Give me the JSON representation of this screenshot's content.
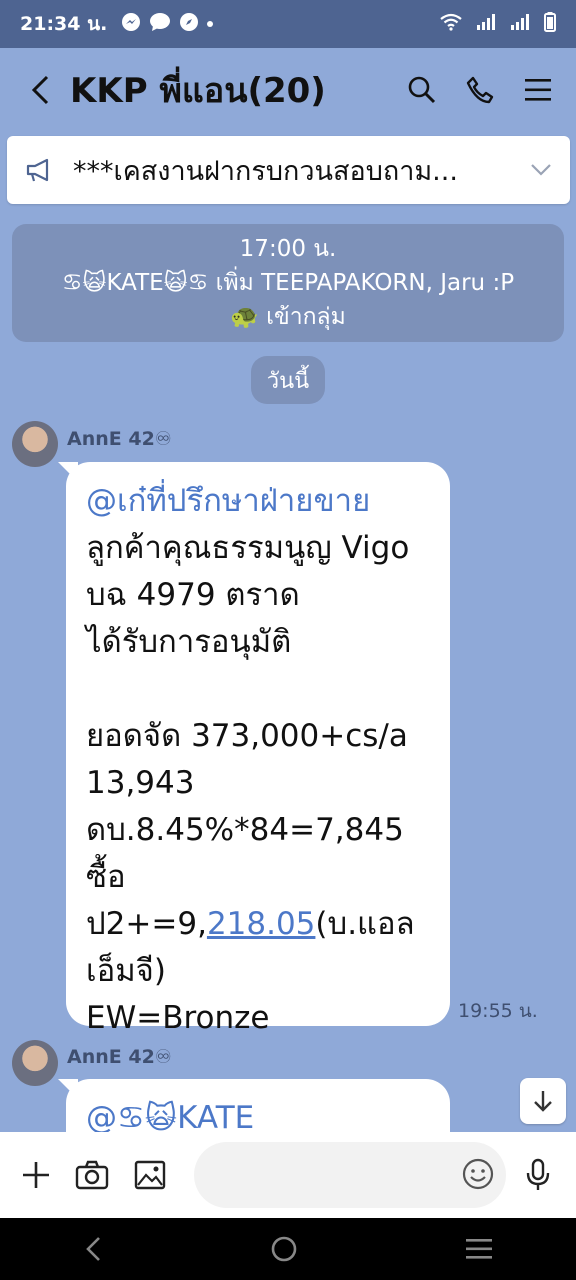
{
  "status_bar": {
    "time": "21:34 น."
  },
  "header": {
    "title": "KKP พี่แอน(20)"
  },
  "announcement": {
    "text": "***เคสงานฝากรบกวนสอบถาม..."
  },
  "system_message": {
    "time": "17:00 น.",
    "line1": "♋🙀KATE🙀♋ เพิ่ม TEEPAPAKORN, Jaru :P",
    "line2": "🐢 เข้ากลุ่ม"
  },
  "date_separator": "วันนี้",
  "messages": [
    {
      "sender": "AnnE 42♾",
      "mention": "@เก๋ที่ปรึกษาฝ่ายขาย",
      "lines": [
        "ลูกค้าคุณธรรมนูญ Vigo",
        "บฉ 4979 ตราด",
        "ได้รับการอนุมัติ",
        "",
        "ยอดจัด 373,000+cs/a",
        "13,943",
        "ดบ.8.45%*84=7,845",
        "ซื้อ"
      ],
      "line_link_prefix": "ป2+=9,",
      "line_link": "218.05",
      "line_link_suffix": "(บ.แอล",
      "lines_after": [
        "เอ็มจี)",
        "EW=Bronze"
      ],
      "time": "19:55 น."
    },
    {
      "sender": "AnnE 42♾",
      "mention": "@♋🙀KATE"
    }
  ],
  "input": {
    "placeholder": ""
  },
  "colors": {
    "chat_background": "#8fa9d8",
    "status_bar": "#4e6491",
    "mention": "#4c78c8"
  }
}
